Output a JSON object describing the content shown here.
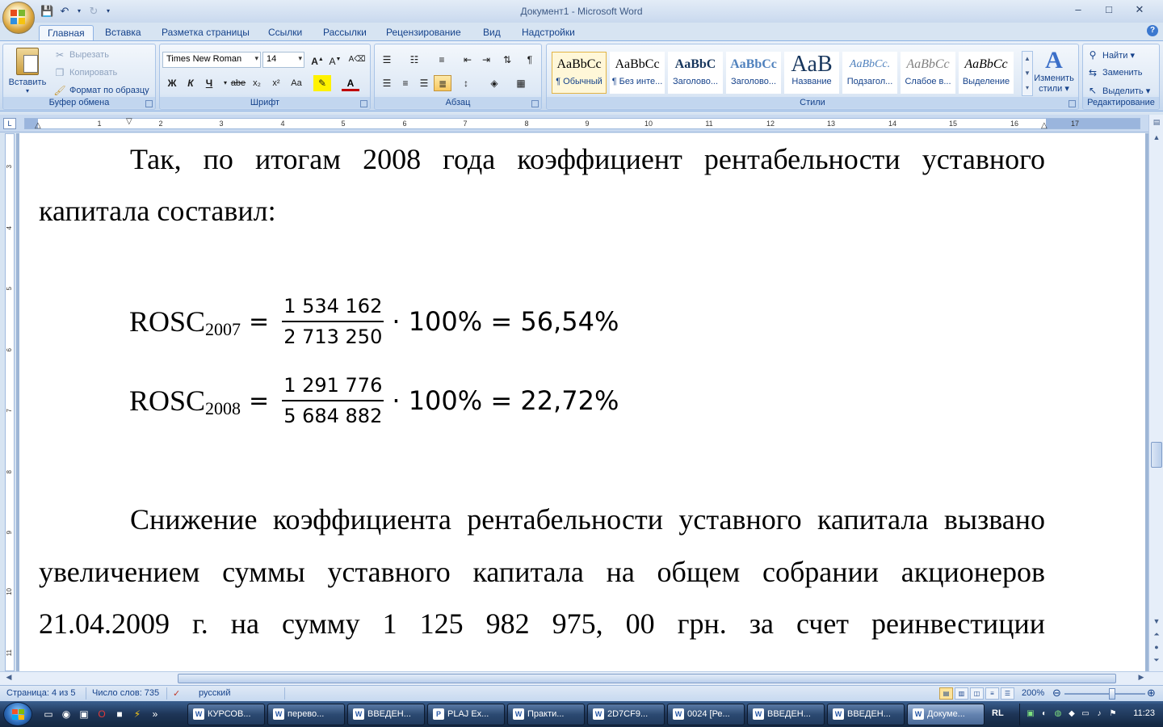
{
  "window": {
    "title": "Документ1 - Microsoft Word",
    "minimize": "–",
    "maximize": "□",
    "close": "✕"
  },
  "ribbon_tabs": [
    "Главная",
    "Вставка",
    "Разметка страницы",
    "Ссылки",
    "Рассылки",
    "Рецензирование",
    "Вид",
    "Надстройки"
  ],
  "clipboard": {
    "paste": "Вставить",
    "cut": "Вырезать",
    "copy": "Копировать",
    "format_painter": "Формат по образцу",
    "label": "Буфер обмена"
  },
  "font": {
    "name": "Times New Roman",
    "size": "14",
    "label": "Шрифт",
    "bold": "Ж",
    "italic": "К",
    "underline": "Ч",
    "strike": "abe",
    "subscript": "x₂",
    "superscript": "x²",
    "case": "Aa"
  },
  "paragraph": {
    "label": "Абзац"
  },
  "styles": {
    "label": "Стили",
    "items": [
      {
        "sample": "AaBbCc",
        "name": "¶ Обычный"
      },
      {
        "sample": "AaBbCc",
        "name": "¶ Без инте..."
      },
      {
        "sample": "AaBbC",
        "name": "Заголово..."
      },
      {
        "sample": "AaBbCc",
        "name": "Заголово..."
      },
      {
        "sample": "AaB",
        "name": "Название"
      },
      {
        "sample": "AaBbCc.",
        "name": "Подзагол..."
      },
      {
        "sample": "AaBbCc",
        "name": "Слабое в..."
      },
      {
        "sample": "AaBbCc",
        "name": "Выделение"
      }
    ],
    "change_styles_line1": "Изменить",
    "change_styles_line2": "стили ▾"
  },
  "editing": {
    "label": "Редактирование",
    "find": "Найти ▾",
    "replace": "Заменить",
    "select": "Выделить ▾"
  },
  "ruler": {
    "h_numbers": [
      "1",
      "1",
      "2",
      "3",
      "4",
      "5",
      "6",
      "7",
      "8",
      "9",
      "10",
      "11",
      "12",
      "13",
      "14",
      "15",
      "16",
      "17"
    ],
    "v_numbers": [
      "3",
      "4",
      "5",
      "6",
      "7",
      "8",
      "9",
      "10",
      "11"
    ]
  },
  "document": {
    "para1": "Так, по итогам 2008 года коэффициент рентабельности уставного",
    "para1_line2": "капитала составил:",
    "formula1": {
      "lhs": "ROSC",
      "sub": "2007",
      "num": "1 534 162",
      "den": "2 713 250",
      "tail": "· 100% = 56,54%"
    },
    "formula2": {
      "lhs": "ROSC",
      "sub": "2008",
      "num": "1 291 776",
      "den": "5 684 882",
      "tail": "· 100% = 22,72%"
    },
    "para2_line1": "Снижение коэффициента рентабельности уставного капитала вызвано",
    "para2_line2": "увеличением суммы уставного капитала на общем собрании акционеров",
    "para2_line3": "21.04.2009 г. на сумму 1 125 982 975, 00 грн. за счет реинвестиции"
  },
  "statusbar": {
    "page": "Страница: 4 из 5",
    "words": "Число слов: 735",
    "language": "русский",
    "zoom": "200%"
  },
  "taskbar": {
    "tasks": [
      {
        "icon": "W",
        "label": "КУРСОВ..."
      },
      {
        "icon": "W",
        "label": "перево..."
      },
      {
        "icon": "W",
        "label": "ВВЕДЕН..."
      },
      {
        "icon": "P",
        "label": "PLAJ Ex..."
      },
      {
        "icon": "W",
        "label": "Практи..."
      },
      {
        "icon": "W",
        "label": "2D7CF9..."
      },
      {
        "icon": "W",
        "label": "0024 [Ре..."
      },
      {
        "icon": "W",
        "label": "ВВЕДЕН..."
      },
      {
        "icon": "W",
        "label": "ВВЕДЕН..."
      },
      {
        "icon": "W",
        "label": "Докуме..."
      }
    ],
    "lang": "RL",
    "clock": "11:23"
  }
}
